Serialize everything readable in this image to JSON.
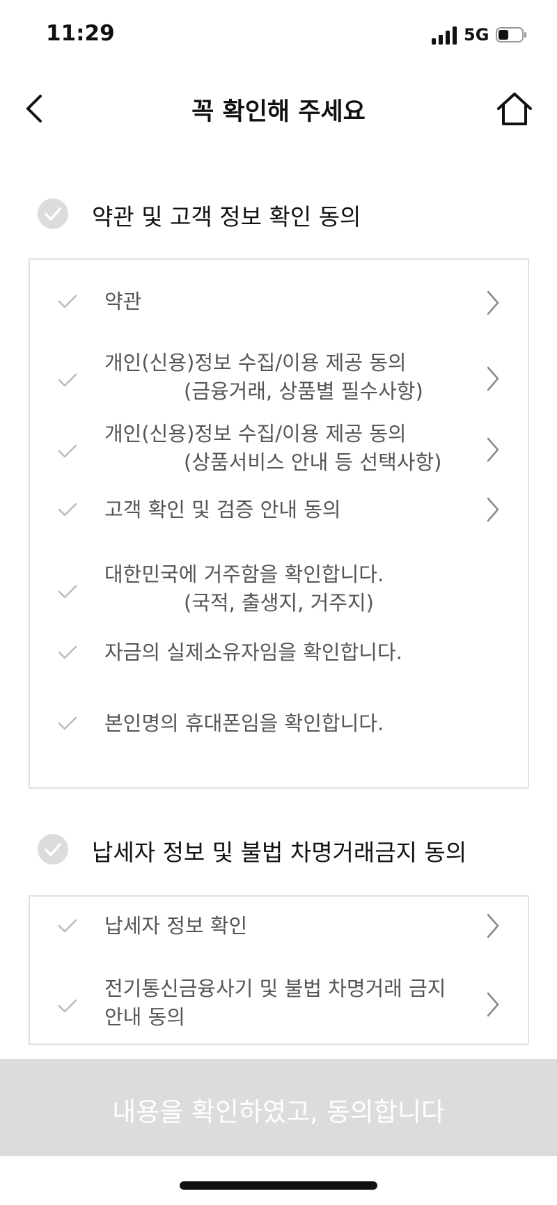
{
  "status": {
    "time": "11:29",
    "network": "5G"
  },
  "header": {
    "title": "꼭 확인해 주세요"
  },
  "section1": {
    "title": "약관 및 고객 정보 확인 동의",
    "items": [
      {
        "line1": "약관",
        "line2": ""
      },
      {
        "line1": "개인(신용)정보 수집/이용 제공 동의",
        "line2": "(금융거래, 상품별 필수사항)"
      },
      {
        "line1": "개인(신용)정보 수집/이용 제공 동의",
        "line2": "(상품서비스 안내 등 선택사항)"
      },
      {
        "line1": "고객 확인 및 검증 안내 동의",
        "line2": ""
      },
      {
        "line1": "대한민국에 거주함을 확인합니다.",
        "line2": "(국적, 출생지, 거주지)"
      },
      {
        "line1": "자금의 실제소유자임을 확인합니다.",
        "line2": ""
      },
      {
        "line1": "본인명의 휴대폰임을 확인합니다.",
        "line2": ""
      }
    ]
  },
  "section2": {
    "title": "납세자 정보 및 불법 차명거래금지 동의",
    "items": [
      {
        "line1": "납세자 정보 확인",
        "line2": ""
      },
      {
        "line1": "전기통신금융사기 및 불법 차명거래 금지",
        "line2": "안내 동의"
      }
    ]
  },
  "footer": {
    "agree_label": "내용을 확인하였고, 동의합니다"
  }
}
